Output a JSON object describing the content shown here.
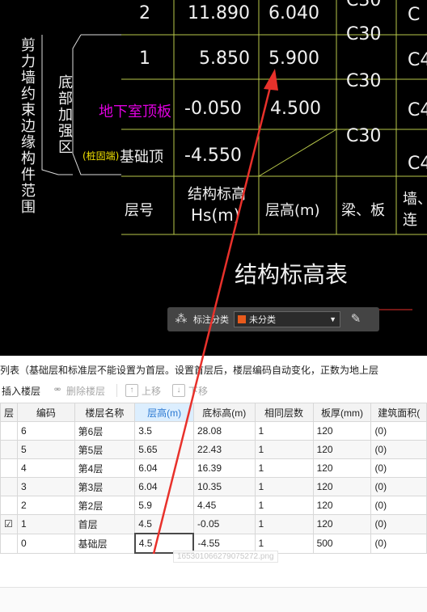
{
  "cad": {
    "vertical_labels": {
      "outer": "剪力墙约束边缘构件范围",
      "inner": "底部加强区"
    },
    "rows": [
      {
        "floor": "2",
        "elev": "11.890",
        "height": "6.040",
        "concrete": "C30",
        "col5": "C"
      },
      {
        "floor": "1",
        "elev": "5.850",
        "height": "5.900",
        "concrete": "C30",
        "col5": "C4"
      },
      {
        "floor": "地下室顶板",
        "elev": "-0.050",
        "height": "4.500",
        "concrete": "C30",
        "col5": "C4"
      },
      {
        "floor_prefix": "(桩固端)",
        "floor": "基础顶",
        "elev": "-4.550",
        "col5": "C4"
      }
    ],
    "header": {
      "floor_no": "层号",
      "struct_elev_1": "结构标高",
      "struct_elev_2": "Hs(m)",
      "height": "层高(m)",
      "beam_slab": "梁、板",
      "wall": "墙、",
      "wall_2": "连"
    },
    "title": "结构标高表",
    "top_partial": "C30"
  },
  "float_toolbar": {
    "label": "标注分类",
    "value": "未分类",
    "swatch_color": "#e85a1c"
  },
  "panel": {
    "info_text": "列表（基础层和标准层不能设置为首层。设置首层后，楼层编码自动变化，正数为地上层",
    "toolbar": {
      "insert": "插入楼层",
      "delete": "删除楼层",
      "up": "上移",
      "down": "下移"
    },
    "columns": [
      "层",
      "编码",
      "楼层名称",
      "层高(m)",
      "底标高(m)",
      "相同层数",
      "板厚(mm)",
      "建筑面积("
    ],
    "rows": [
      {
        "first": "",
        "code": "6",
        "name": "第6层",
        "height": "3.5",
        "bottom": "28.08",
        "same": "1",
        "thick": "120",
        "area": "(0)"
      },
      {
        "first": "",
        "code": "5",
        "name": "第5层",
        "height": "5.65",
        "bottom": "22.43",
        "same": "1",
        "thick": "120",
        "area": "(0)"
      },
      {
        "first": "",
        "code": "4",
        "name": "第4层",
        "height": "6.04",
        "bottom": "16.39",
        "same": "1",
        "thick": "120",
        "area": "(0)"
      },
      {
        "first": "",
        "code": "3",
        "name": "第3层",
        "height": "6.04",
        "bottom": "10.35",
        "same": "1",
        "thick": "120",
        "area": "(0)"
      },
      {
        "first": "",
        "code": "2",
        "name": "第2层",
        "height": "5.9",
        "bottom": "4.45",
        "same": "1",
        "thick": "120",
        "area": "(0)"
      },
      {
        "first": "☑",
        "code": "1",
        "name": "首层",
        "height": "4.5",
        "bottom": "-0.05",
        "same": "1",
        "thick": "120",
        "area": "(0)"
      },
      {
        "first": "",
        "code": "0",
        "name": "基础层",
        "height": "4.5",
        "bottom": "-4.55",
        "same": "1",
        "thick": "500",
        "area": "(0)"
      }
    ],
    "tooltip": "1653010662790752​72.png"
  },
  "colors": {
    "arrow": "#e8312b",
    "magenta": "#e000e0",
    "yellow": "#f0e000",
    "grid_line": "#b8c84a"
  }
}
